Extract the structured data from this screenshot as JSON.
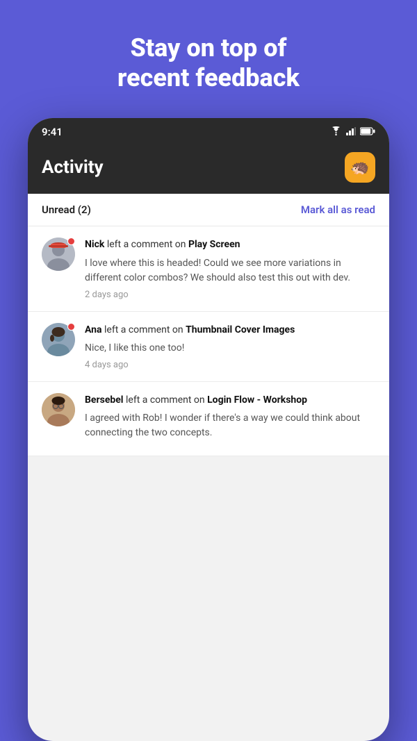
{
  "hero": {
    "title": "Stay on top of\nrecent feedback"
  },
  "status_bar": {
    "time": "9:41"
  },
  "app_header": {
    "title": "Activity"
  },
  "unread_section": {
    "label": "Unread (2)",
    "mark_all_read": "Mark all as read"
  },
  "activity_items": [
    {
      "id": "nick",
      "username": "Nick",
      "action": " left a comment on ",
      "screen": "Play Screen",
      "body": "I love where this is headed! Could we see more variations in different color combos? We should also test this out with dev.",
      "time": "2 days ago",
      "unread": true,
      "avatar_color": "#b0b5c0"
    },
    {
      "id": "ana",
      "username": "Ana",
      "action": " left a comment on ",
      "screen": "Thumbnail Cover Images",
      "body": "Nice, I like this one too!",
      "time": "4 days ago",
      "unread": true,
      "avatar_color": "#8fa4b8"
    },
    {
      "id": "bersebel",
      "username": "Bersebel",
      "action": " left a comment on ",
      "screen": "Login Flow - Workshop",
      "body": "I agreed with Rob! I wonder if there's a way we could think about connecting the two concepts.",
      "time": "",
      "unread": false,
      "avatar_color": "#c8a882"
    }
  ],
  "colors": {
    "accent": "#5B5BD6",
    "unread_dot": "#E53E3E",
    "mark_read": "#5B5BD6"
  }
}
